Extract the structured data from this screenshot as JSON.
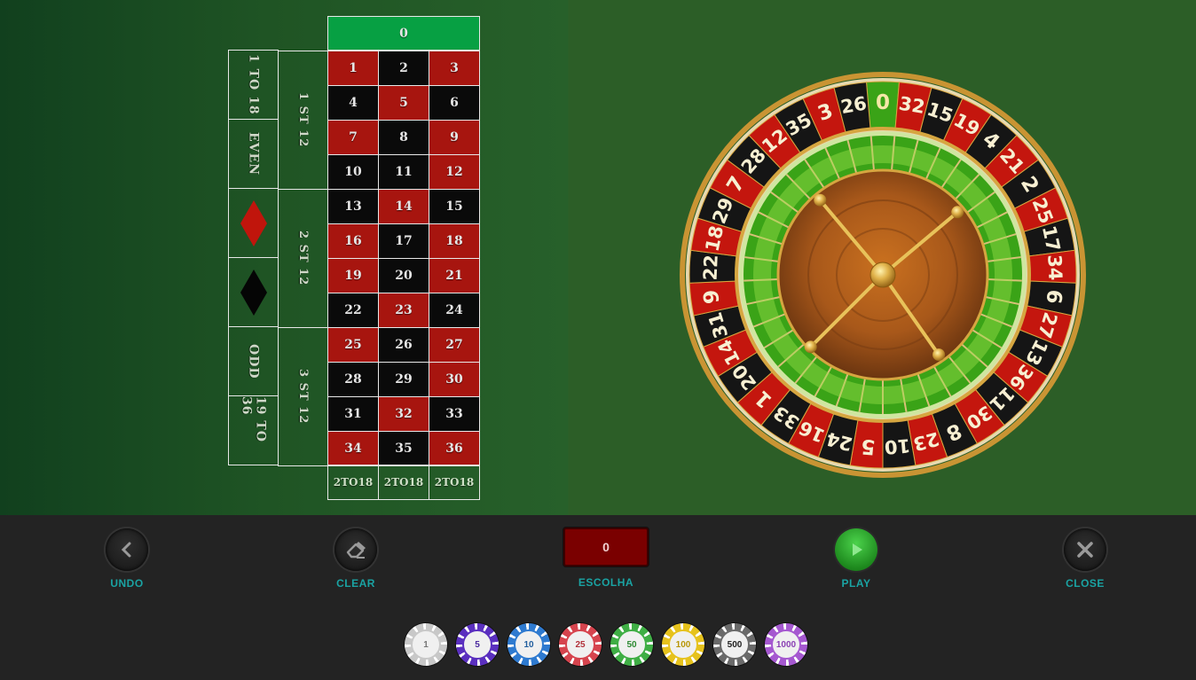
{
  "zero": "0",
  "numbers": [
    [
      "1",
      "red"
    ],
    [
      "2",
      "black"
    ],
    [
      "3",
      "red"
    ],
    [
      "4",
      "black"
    ],
    [
      "5",
      "red"
    ],
    [
      "6",
      "black"
    ],
    [
      "7",
      "red"
    ],
    [
      "8",
      "black"
    ],
    [
      "9",
      "red"
    ],
    [
      "10",
      "black"
    ],
    [
      "11",
      "black"
    ],
    [
      "12",
      "red"
    ],
    [
      "13",
      "black"
    ],
    [
      "14",
      "red"
    ],
    [
      "15",
      "black"
    ],
    [
      "16",
      "red"
    ],
    [
      "17",
      "black"
    ],
    [
      "18",
      "red"
    ],
    [
      "19",
      "red"
    ],
    [
      "20",
      "black"
    ],
    [
      "21",
      "red"
    ],
    [
      "22",
      "black"
    ],
    [
      "23",
      "red"
    ],
    [
      "24",
      "black"
    ],
    [
      "25",
      "red"
    ],
    [
      "26",
      "black"
    ],
    [
      "27",
      "red"
    ],
    [
      "28",
      "black"
    ],
    [
      "29",
      "black"
    ],
    [
      "30",
      "red"
    ],
    [
      "31",
      "black"
    ],
    [
      "32",
      "red"
    ],
    [
      "33",
      "black"
    ],
    [
      "34",
      "red"
    ],
    [
      "35",
      "black"
    ],
    [
      "36",
      "red"
    ]
  ],
  "dozens": [
    "1 ST 12",
    "2 ST 12",
    "3 ST 12"
  ],
  "outside": {
    "low": "1 TO 18",
    "even": "EVEN",
    "red_icon": "red-diamond",
    "black_icon": "black-diamond",
    "odd": "ODD",
    "high": "19 TO 36"
  },
  "columns": [
    "2TO18",
    "2TO18",
    "2TO18"
  ],
  "wheel_numbers": [
    "0",
    "32",
    "15",
    "19",
    "4",
    "21",
    "2",
    "25",
    "17",
    "34",
    "6",
    "27",
    "13",
    "36",
    "11",
    "30",
    "8",
    "23",
    "10",
    "5",
    "24",
    "16",
    "33",
    "1",
    "20",
    "14",
    "31",
    "9",
    "22",
    "18",
    "29",
    "7",
    "28",
    "12",
    "35",
    "3",
    "26"
  ],
  "wheel_colors": {
    "red": "#c4160e",
    "black": "#151515",
    "green": "#3aa317",
    "gold": "#d6a640"
  },
  "controls": {
    "undo": "UNDO",
    "clear": "CLEAR",
    "escolha_label": "ESCOLHA",
    "escolha_value": "0",
    "play": "PLAY",
    "close": "CLOSE"
  },
  "chips": [
    {
      "value": "1",
      "color": "#c8c8c8",
      "text": "#777777"
    },
    {
      "value": "5",
      "color": "#5a2fbf",
      "text": "#4a2a9e"
    },
    {
      "value": "10",
      "color": "#2e7ad0",
      "text": "#215e9e"
    },
    {
      "value": "25",
      "color": "#d6444e",
      "text": "#b2323b"
    },
    {
      "value": "50",
      "color": "#3fae45",
      "text": "#2d8a33"
    },
    {
      "value": "100",
      "color": "#e6c21c",
      "text": "#b89608"
    },
    {
      "value": "500",
      "color": "#6a6a6a",
      "text": "#222222"
    },
    {
      "value": "1000",
      "color": "#a558d0",
      "text": "#8a3fb4"
    }
  ]
}
